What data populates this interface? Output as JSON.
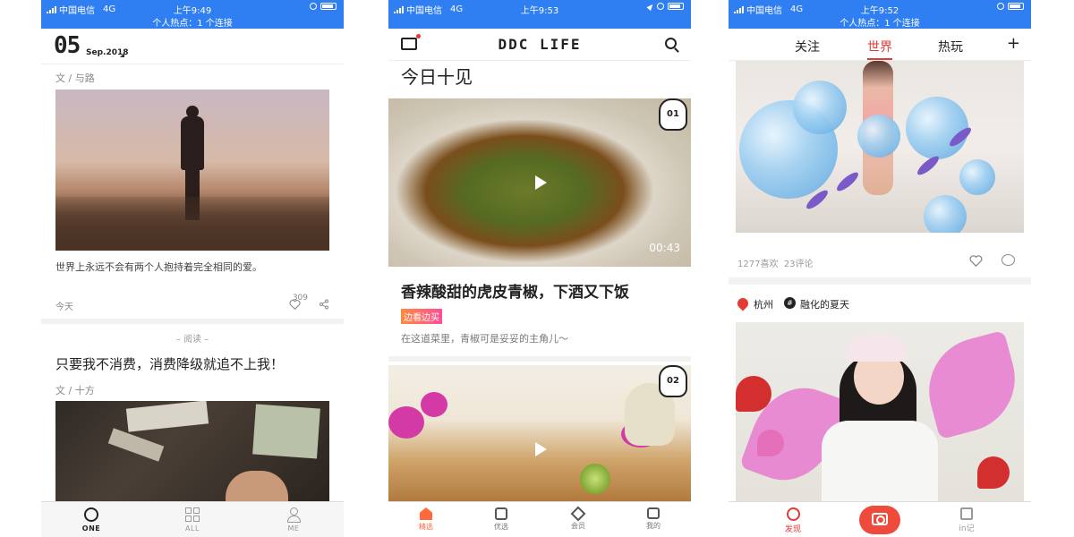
{
  "status_bars": [
    {
      "carrier": "中国电信",
      "network": "4G",
      "time": "上午9:49",
      "hotspot": "个人热点：1 个连接"
    },
    {
      "carrier": "中国电信",
      "network": "4G",
      "time": "上午9:53",
      "hotspot": ""
    },
    {
      "carrier": "中国电信",
      "network": "4G",
      "time": "上午9:52",
      "hotspot": "个人热点：1 个连接"
    }
  ],
  "colors": {
    "status_blue": "#2f7ff2",
    "ddc_orange": "#ff6a3d",
    "accent_red": "#e53935"
  },
  "one": {
    "day": "05",
    "month": "Sep.2018",
    "card1": {
      "author": "文 / 与路",
      "quote": "世界上永远不会有两个人抱持着完全相同的爱。",
      "date": "今天",
      "likes": "309"
    },
    "read_label": "– 阅读 –",
    "card2": {
      "title": "只要我不消费，消费降级就追不上我！",
      "author": "文 / 十方"
    },
    "tabs": [
      {
        "label": "ONE",
        "icon": "one-ring-icon",
        "active": true
      },
      {
        "label": "ALL",
        "icon": "grid-icon",
        "active": false
      },
      {
        "label": "ME",
        "icon": "person-icon",
        "active": false
      }
    ]
  },
  "ddc": {
    "brand": "DDC LIFE",
    "section": "今日十见",
    "item1": {
      "badge": "01",
      "duration": "00:43",
      "title": "香辣酸甜的虎皮青椒，下酒又下饭",
      "tag": "边看边买",
      "desc": "在这道菜里，青椒可是妥妥的主角儿～"
    },
    "item2": {
      "badge": "02"
    },
    "tabs": [
      {
        "label": "精选",
        "icon": "home-icon",
        "active": true
      },
      {
        "label": "优选",
        "icon": "box-icon",
        "active": false
      },
      {
        "label": "会员",
        "icon": "diamond-icon",
        "active": false
      },
      {
        "label": "我的",
        "icon": "cat-face-icon",
        "active": false
      }
    ]
  },
  "inphoto": {
    "tabs": [
      "关注",
      "世界",
      "热玩"
    ],
    "active_tab": "世界",
    "add": "+",
    "post1": {
      "likes": "1277喜欢",
      "comments": "23评论"
    },
    "post2": {
      "location": "杭州",
      "topic": "融化的夏天",
      "hash": "#"
    },
    "bottom": [
      {
        "label": "发现",
        "icon": "discover-icon",
        "active": true
      },
      {
        "label": "",
        "icon": "camera-icon",
        "active": false
      },
      {
        "label": "in记",
        "icon": "journal-icon",
        "active": false
      }
    ]
  }
}
